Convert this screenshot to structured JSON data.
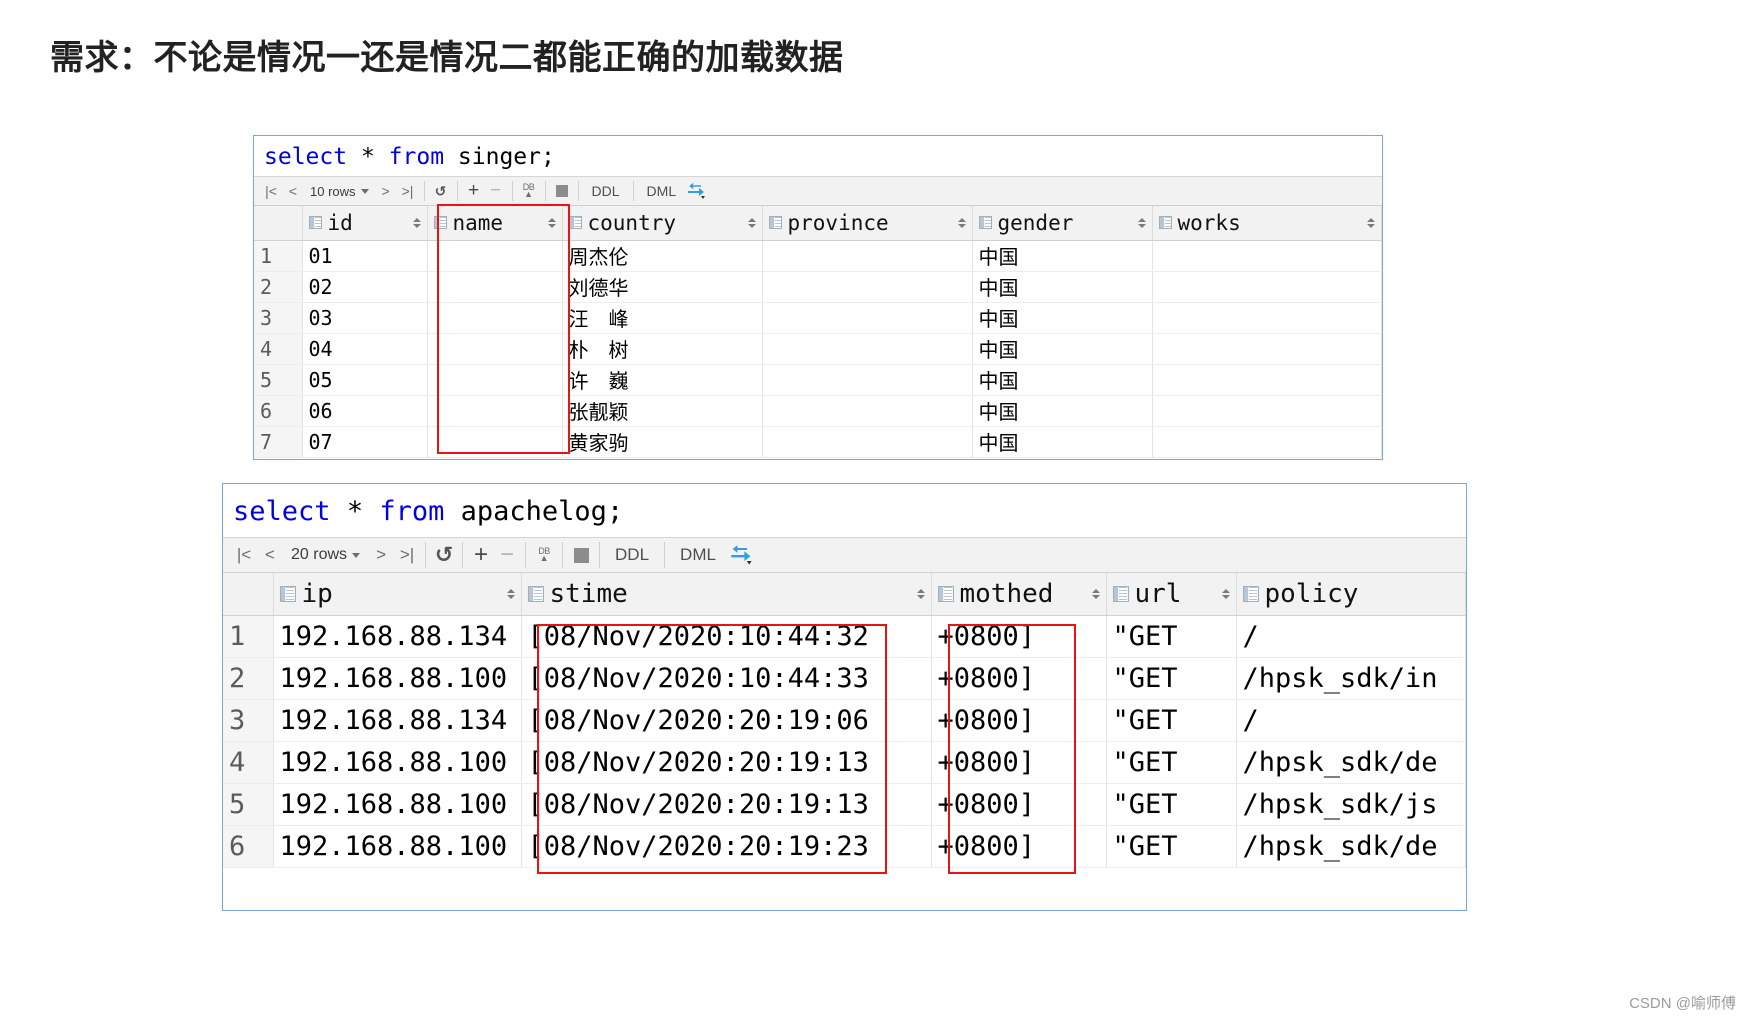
{
  "page": {
    "title": "需求：不论是情况一还是情况二都能正确的加载数据",
    "watermark": "CSDN @喻师傅"
  },
  "toolbar_common": {
    "first_icon": "|<",
    "prev_icon": "<",
    "next_icon": ">",
    "last_icon": ">|",
    "refresh_icon": "refresh-icon",
    "add_icon": "+",
    "remove_icon": "−",
    "db_icon_text": "DB",
    "db_icon_arrow": "▲",
    "stop_icon": "stop-icon",
    "ddl_label": "DDL",
    "dml_label": "DML",
    "transaction_icon": "transaction-icon"
  },
  "panel_singer": {
    "sql": {
      "keyword1": "select",
      "star": "*",
      "keyword2": "from",
      "table": "singer;"
    },
    "rows_label": "10 rows",
    "columns": [
      "",
      "id",
      "name",
      "country",
      "province",
      "gender",
      "works"
    ],
    "rows": [
      {
        "n": "1",
        "id": "01",
        "name": "",
        "country": "周杰伦",
        "province": "",
        "gender": "中国",
        "works": ""
      },
      {
        "n": "2",
        "id": "02",
        "name": "",
        "country": "刘德华",
        "province": "",
        "gender": "中国",
        "works": ""
      },
      {
        "n": "3",
        "id": "03",
        "name": "",
        "country": "汪　峰",
        "province": "",
        "gender": "中国",
        "works": ""
      },
      {
        "n": "4",
        "id": "04",
        "name": "",
        "country": "朴　树",
        "province": "",
        "gender": "中国",
        "works": ""
      },
      {
        "n": "5",
        "id": "05",
        "name": "",
        "country": "许　巍",
        "province": "",
        "gender": "中国",
        "works": ""
      },
      {
        "n": "6",
        "id": "06",
        "name": "",
        "country": "张靓颖",
        "province": "",
        "gender": "中国",
        "works": ""
      },
      {
        "n": "7",
        "id": "07",
        "name": "",
        "country": "黄家驹",
        "province": "",
        "gender": "中国",
        "works": ""
      }
    ]
  },
  "panel_apachelog": {
    "sql": {
      "keyword1": "select",
      "star": "*",
      "keyword2": "from",
      "table": "apachelog;"
    },
    "rows_label": "20 rows",
    "columns": [
      "",
      "ip",
      "stime",
      "mothed",
      "url",
      "policy"
    ],
    "rows": [
      {
        "n": "1",
        "ip": "192.168.88.134",
        "stime": "[08/Nov/2020:10:44:32",
        "mothed": "+0800]",
        "url": "\"GET",
        "policy": "/"
      },
      {
        "n": "2",
        "ip": "192.168.88.100",
        "stime": "[08/Nov/2020:10:44:33",
        "mothed": "+0800]",
        "url": "\"GET",
        "policy": "/hpsk_sdk/in"
      },
      {
        "n": "3",
        "ip": "192.168.88.134",
        "stime": "[08/Nov/2020:20:19:06",
        "mothed": "+0800]",
        "url": "\"GET",
        "policy": "/"
      },
      {
        "n": "4",
        "ip": "192.168.88.100",
        "stime": "[08/Nov/2020:20:19:13",
        "mothed": "+0800]",
        "url": "\"GET",
        "policy": "/hpsk_sdk/de"
      },
      {
        "n": "5",
        "ip": "192.168.88.100",
        "stime": "[08/Nov/2020:20:19:13",
        "mothed": "+0800]",
        "url": "\"GET",
        "policy": "/hpsk_sdk/js"
      },
      {
        "n": "6",
        "ip": "192.168.88.100",
        "stime": "[08/Nov/2020:20:19:23",
        "mothed": "+0800]",
        "url": "\"GET",
        "policy": "/hpsk_sdk/de"
      }
    ]
  },
  "annotations": {
    "highlight_color": "#e81313",
    "boxes": [
      {
        "label": "singer-name-column-highlight"
      },
      {
        "label": "apachelog-stime-column-highlight"
      },
      {
        "label": "apachelog-mothed-column-highlight"
      }
    ]
  }
}
